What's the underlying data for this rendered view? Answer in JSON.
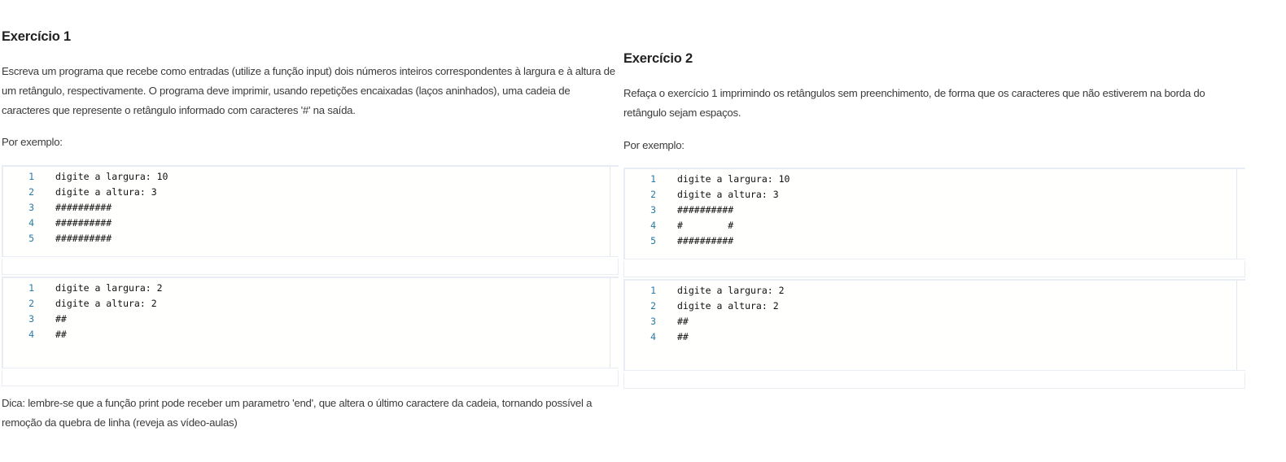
{
  "exercise1": {
    "title": "Exercício 1",
    "description": "Escreva um programa que recebe como entradas (utilize a função input) dois números inteiros correspondentes à largura e à altura de um retângulo, respectivamente. O programa deve imprimir, usando repetições encaixadas (laços aninhados), uma cadeia de caracteres que represente o retângulo informado com caracteres '#' na saída.",
    "example_label": "Por exemplo:",
    "examples": [
      [
        "digite a largura: 10",
        "digite a altura: 3",
        "##########",
        "##########",
        "##########"
      ],
      [
        "digite a largura: 2",
        "digite a altura: 2",
        "##",
        "##"
      ]
    ],
    "hint": "Dica: lembre-se que a função print pode receber um parametro 'end', que altera o último caractere da cadeia, tornando possível a remoção da quebra de linha (reveja as vídeo-aulas)"
  },
  "exercise2": {
    "title": "Exercício 2",
    "description": "Refaça o exercício 1 imprimindo os retângulos sem preenchimento, de forma que os caracteres que não estiverem na borda do retângulo sejam espaços.",
    "example_label": "Por exemplo:",
    "examples": [
      [
        "digite a largura: 10",
        "digite a altura: 3",
        "##########",
        "#        #",
        "##########"
      ],
      [
        "digite a largura: 2",
        "digite a altura: 2",
        "##",
        "##"
      ]
    ]
  }
}
